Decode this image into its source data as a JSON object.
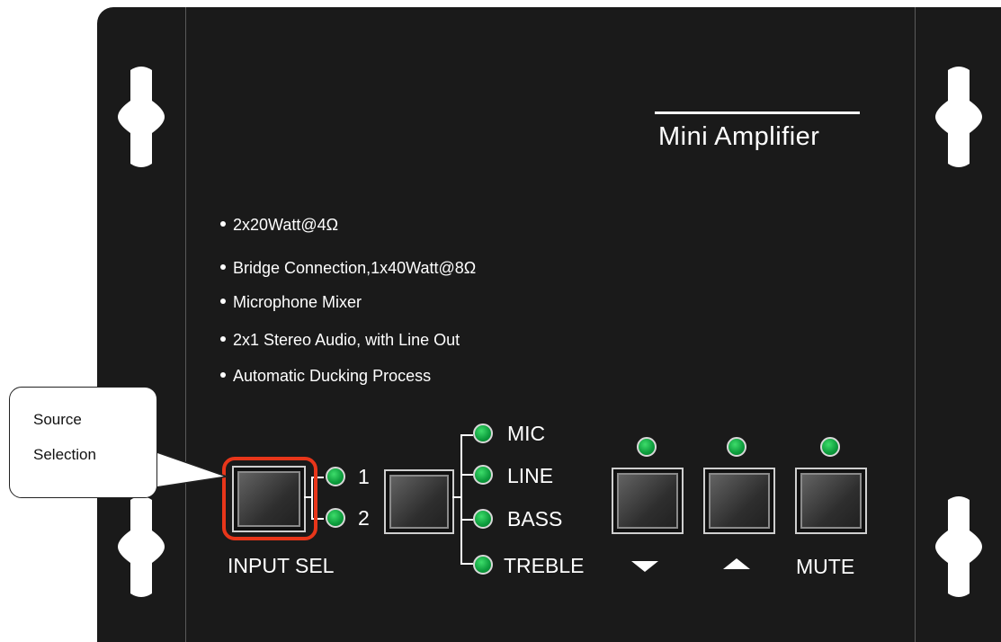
{
  "device": {
    "title": "Mini Amplifier",
    "features": [
      "2x20Watt@4Ω",
      "Bridge Connection,1x40Watt@8Ω",
      "Microphone Mixer",
      "2x1 Stereo Audio, with Line Out",
      "Automatic Ducking Process"
    ],
    "input_sel": {
      "label": "INPUT SEL",
      "led_labels": [
        "1",
        "2"
      ]
    },
    "mode": {
      "led_labels": [
        "MIC",
        "LINE",
        "BASS",
        "TREBLE"
      ]
    },
    "controls": {
      "mute_label": "MUTE"
    }
  },
  "callout": {
    "line1": "Source",
    "line2": "Selection"
  },
  "colors": {
    "panel": "#1a1a1a",
    "led": "#0c9b3c",
    "highlight": "#e8361a"
  },
  "icons": {
    "down": "triangle-down-icon",
    "up": "triangle-up-icon"
  }
}
